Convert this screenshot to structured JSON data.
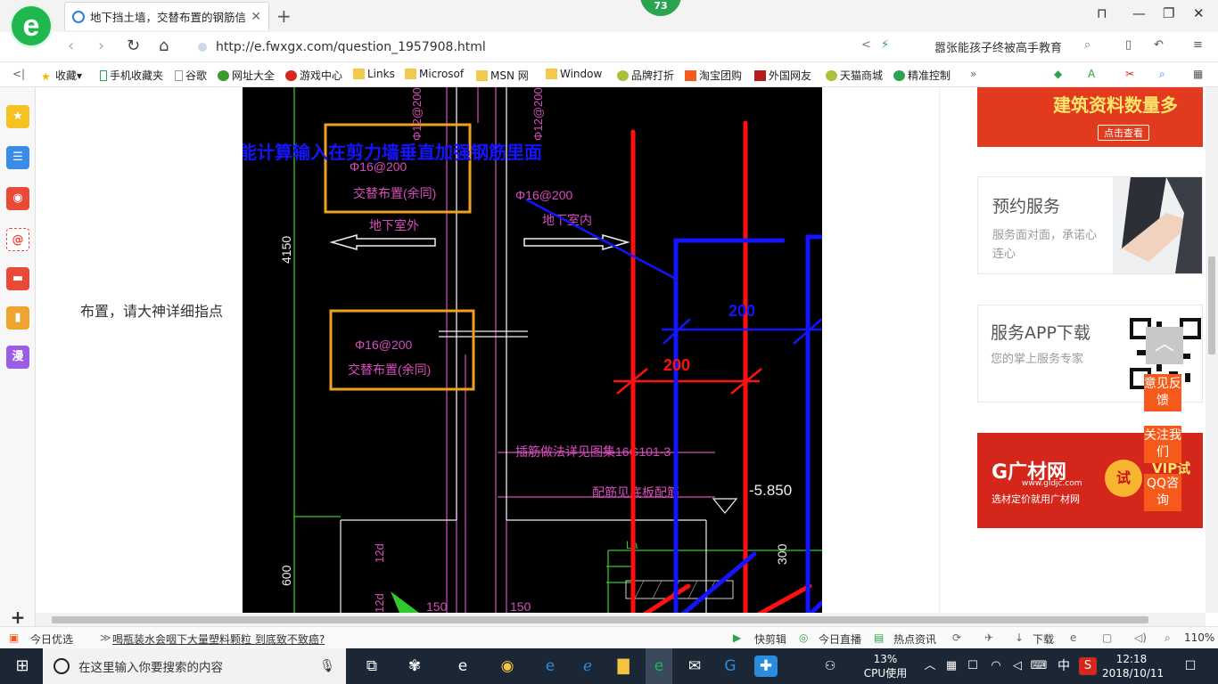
{
  "browser": {
    "tab_title": "地下挡土墙，交替布置的钢筋信息",
    "badge": "73",
    "url": "http://e.fwxgx.com/question_1957908.html",
    "search_hint": "嚣张能孩子终被高手教育",
    "new_tab": "+",
    "window_controls": [
      "⊓",
      "—",
      "❐",
      "✕"
    ]
  },
  "bookmarks": [
    "收藏",
    "手机收藏夹",
    "谷歌",
    "网址大全",
    "游戏中心",
    "Links",
    "Microsof",
    "MSN 网",
    "Window",
    "品牌打折",
    "淘宝团购",
    "外国网友",
    "天猫商城",
    "精准控制"
  ],
  "page": {
    "question_text": "布置，请大神详细指点",
    "cad_annotation": "只能计算输入在剪力墙垂直加强钢筋里面",
    "dim_blue": "200",
    "dim_red": "200",
    "cad_labels": {
      "rebar1": "Φ16@200",
      "alt1": "交替布置(余同)",
      "outside": "地下室外",
      "rebar2": "Φ16@200",
      "inside": "地下室内",
      "rebar3": "Φ16@200",
      "alt2": "交替布置(余同)",
      "height": "4150",
      "anchor": "插筋做法详见图集16G101-3",
      "slab": "配筋见底板配筋",
      "elev": "-5.850",
      "h600": "600",
      "h300": "300",
      "d12a": "12d",
      "d12b": "12d",
      "v150a": "150",
      "v150b": "150",
      "la": "La",
      "top1": "Φ12@200",
      "top2": "Φ12@200"
    }
  },
  "ads": {
    "top_title": "建筑资料数量多",
    "top_btn": "点击查看",
    "service_title": "预约服务",
    "service_sub": "服务面对面，承诺心连心",
    "app_title": "服务APP下载",
    "app_sub": "您的掌上服务专家",
    "gc_logo": "G广材网",
    "gc_url": "www.gldjc.com",
    "gc_sub": "选材定价就用广材网",
    "gc_try": "试",
    "gc_vip": "VIP试用"
  },
  "float_buttons": [
    "意见反馈",
    "关注我们",
    "QQ咨询"
  ],
  "status": {
    "left1": "今日优选",
    "news": "喝瓶装水会咽下大量塑料颗粒 到底致不致癌?",
    "quick_cut": "快剪辑",
    "live": "今日直播",
    "hot": "热点资讯",
    "download": "下载",
    "zoom": "110%"
  },
  "taskbar": {
    "search_placeholder": "在这里输入你要搜索的内容",
    "cpu_percent": "13%",
    "cpu_label": "CPU使用",
    "ime": "中",
    "time": "12:18",
    "date": "2018/10/11"
  },
  "colors": {
    "accent_green": "#1fb84f",
    "orange": "#f55a1a",
    "cad_red": "#ff0000",
    "cad_blue": "#0000ff"
  }
}
